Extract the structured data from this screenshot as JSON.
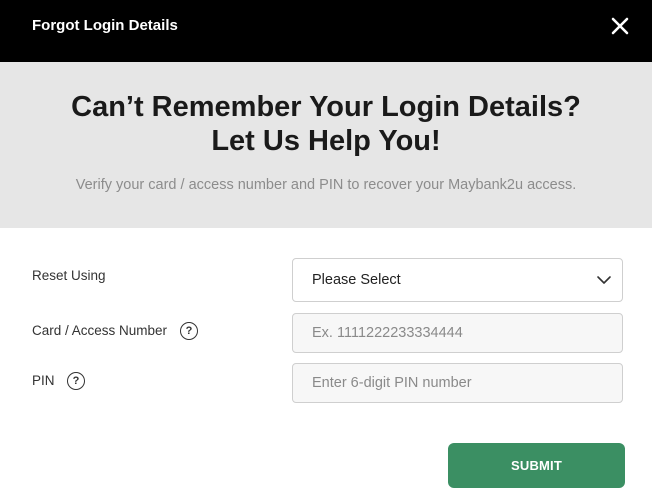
{
  "header": {
    "title": "Forgot Login Details",
    "close_icon": "close-icon"
  },
  "hero": {
    "title_line1": "Can’t Remember Your Login Details?",
    "title_line2": "Let Us Help You!",
    "subtitle": "Verify your card / access number and PIN to recover your Maybank2u access."
  },
  "form": {
    "reset_using": {
      "label": "Reset Using",
      "selected": "Please Select"
    },
    "card_number": {
      "label": "Card / Access Number",
      "help_icon": "question-circle-icon",
      "help_glyph": "?",
      "placeholder": "Ex. 1111222233334444",
      "value": ""
    },
    "pin": {
      "label": "PIN",
      "help_icon": "question-circle-icon",
      "help_glyph": "?",
      "placeholder": "Enter 6-digit PIN number",
      "value": ""
    },
    "submit_label": "SUBMIT"
  },
  "colors": {
    "header_bg": "#000000",
    "hero_bg": "#e6e6e6",
    "submit_bg": "#3b8f63"
  }
}
